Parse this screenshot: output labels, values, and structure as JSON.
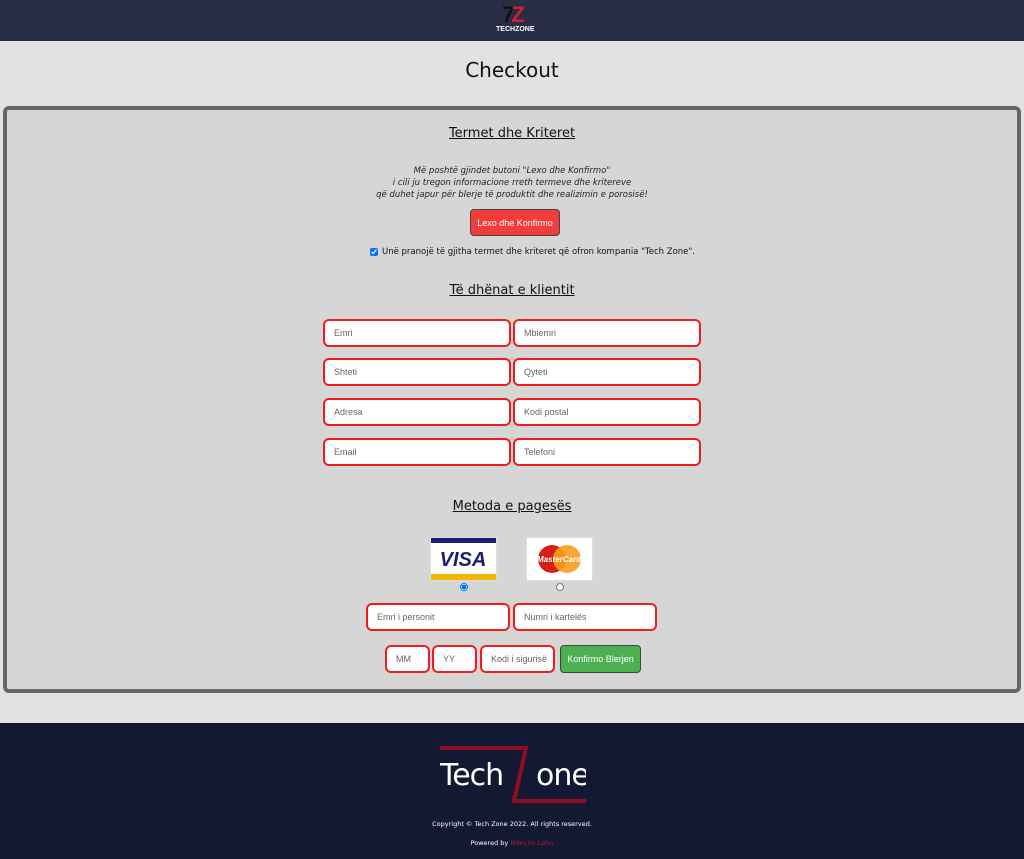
{
  "header": {
    "logo_mark": "TZ",
    "logo_text": "TECHZONE"
  },
  "page_title": "Checkout",
  "terms": {
    "heading": "Termet dhe Kriteret",
    "note_lines": [
      "Më poshtë gjindet butoni \"Lexo dhe Konfirmo\"",
      "i cili ju tregon informacione rreth termeve dhe kritereve",
      "që duhet japur për blerje të produktit dhe realizimin e porosisë!"
    ],
    "read_button": "Lexo dhe Konfirmo",
    "agree_label": "Unë pranojë të gjitha termet dhe kriteret që ofron kompania \"Tech Zone\".",
    "agree_checked": true
  },
  "customer": {
    "heading": "Të dhënat e klientit",
    "fields": [
      {
        "placeholder": "Emri",
        "value": ""
      },
      {
        "placeholder": "Mbiemri",
        "value": ""
      },
      {
        "placeholder": "Shteti",
        "value": ""
      },
      {
        "placeholder": "Qyteti",
        "value": ""
      },
      {
        "placeholder": "Adresa",
        "value": ""
      },
      {
        "placeholder": "Kodi postal",
        "value": ""
      },
      {
        "placeholder": "Email",
        "value": ""
      },
      {
        "placeholder": "Telefoni",
        "value": ""
      }
    ]
  },
  "payment": {
    "heading": "Metoda e pagesës",
    "methods": [
      {
        "name": "VISA",
        "selected": true
      },
      {
        "name": "MasterCard",
        "selected": false
      }
    ],
    "fields": {
      "holder": "Emri i personit",
      "number": "Numri i kartelës",
      "mm": "MM",
      "yy": "YY",
      "cvv": "Kodi i sigurisë"
    },
    "confirm_button": "Konfirmo Blerjen"
  },
  "footer": {
    "logo_text": "TechZone",
    "copyright": "Copyright © Tech Zone 2022. All rights reserved.",
    "powered_by": "Powered by",
    "author": "Ndriçim Lahu"
  },
  "colors": {
    "header": "#282c44",
    "footer": "#141933",
    "accent_red": "#f33c3c",
    "confirm_green": "#4caf50",
    "input_border": "#ee1c1c"
  }
}
